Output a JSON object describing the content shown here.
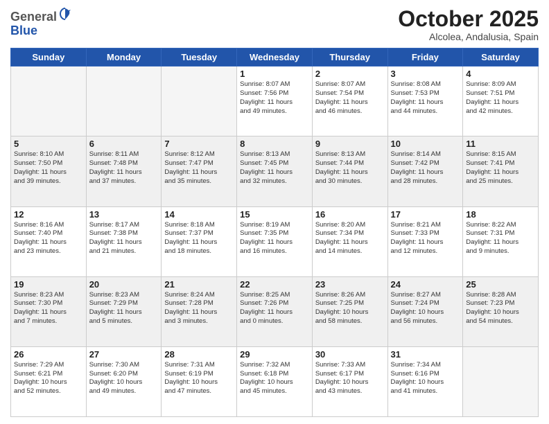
{
  "header": {
    "logo_general": "General",
    "logo_blue": "Blue",
    "month_title": "October 2025",
    "location": "Alcolea, Andalusia, Spain"
  },
  "days_of_week": [
    "Sunday",
    "Monday",
    "Tuesday",
    "Wednesday",
    "Thursday",
    "Friday",
    "Saturday"
  ],
  "weeks": [
    [
      {
        "day": "",
        "content": ""
      },
      {
        "day": "",
        "content": ""
      },
      {
        "day": "",
        "content": ""
      },
      {
        "day": "1",
        "content": "Sunrise: 8:07 AM\nSunset: 7:56 PM\nDaylight: 11 hours\nand 49 minutes."
      },
      {
        "day": "2",
        "content": "Sunrise: 8:07 AM\nSunset: 7:54 PM\nDaylight: 11 hours\nand 46 minutes."
      },
      {
        "day": "3",
        "content": "Sunrise: 8:08 AM\nSunset: 7:53 PM\nDaylight: 11 hours\nand 44 minutes."
      },
      {
        "day": "4",
        "content": "Sunrise: 8:09 AM\nSunset: 7:51 PM\nDaylight: 11 hours\nand 42 minutes."
      }
    ],
    [
      {
        "day": "5",
        "content": "Sunrise: 8:10 AM\nSunset: 7:50 PM\nDaylight: 11 hours\nand 39 minutes."
      },
      {
        "day": "6",
        "content": "Sunrise: 8:11 AM\nSunset: 7:48 PM\nDaylight: 11 hours\nand 37 minutes."
      },
      {
        "day": "7",
        "content": "Sunrise: 8:12 AM\nSunset: 7:47 PM\nDaylight: 11 hours\nand 35 minutes."
      },
      {
        "day": "8",
        "content": "Sunrise: 8:13 AM\nSunset: 7:45 PM\nDaylight: 11 hours\nand 32 minutes."
      },
      {
        "day": "9",
        "content": "Sunrise: 8:13 AM\nSunset: 7:44 PM\nDaylight: 11 hours\nand 30 minutes."
      },
      {
        "day": "10",
        "content": "Sunrise: 8:14 AM\nSunset: 7:42 PM\nDaylight: 11 hours\nand 28 minutes."
      },
      {
        "day": "11",
        "content": "Sunrise: 8:15 AM\nSunset: 7:41 PM\nDaylight: 11 hours\nand 25 minutes."
      }
    ],
    [
      {
        "day": "12",
        "content": "Sunrise: 8:16 AM\nSunset: 7:40 PM\nDaylight: 11 hours\nand 23 minutes."
      },
      {
        "day": "13",
        "content": "Sunrise: 8:17 AM\nSunset: 7:38 PM\nDaylight: 11 hours\nand 21 minutes."
      },
      {
        "day": "14",
        "content": "Sunrise: 8:18 AM\nSunset: 7:37 PM\nDaylight: 11 hours\nand 18 minutes."
      },
      {
        "day": "15",
        "content": "Sunrise: 8:19 AM\nSunset: 7:35 PM\nDaylight: 11 hours\nand 16 minutes."
      },
      {
        "day": "16",
        "content": "Sunrise: 8:20 AM\nSunset: 7:34 PM\nDaylight: 11 hours\nand 14 minutes."
      },
      {
        "day": "17",
        "content": "Sunrise: 8:21 AM\nSunset: 7:33 PM\nDaylight: 11 hours\nand 12 minutes."
      },
      {
        "day": "18",
        "content": "Sunrise: 8:22 AM\nSunset: 7:31 PM\nDaylight: 11 hours\nand 9 minutes."
      }
    ],
    [
      {
        "day": "19",
        "content": "Sunrise: 8:23 AM\nSunset: 7:30 PM\nDaylight: 11 hours\nand 7 minutes."
      },
      {
        "day": "20",
        "content": "Sunrise: 8:23 AM\nSunset: 7:29 PM\nDaylight: 11 hours\nand 5 minutes."
      },
      {
        "day": "21",
        "content": "Sunrise: 8:24 AM\nSunset: 7:28 PM\nDaylight: 11 hours\nand 3 minutes."
      },
      {
        "day": "22",
        "content": "Sunrise: 8:25 AM\nSunset: 7:26 PM\nDaylight: 11 hours\nand 0 minutes."
      },
      {
        "day": "23",
        "content": "Sunrise: 8:26 AM\nSunset: 7:25 PM\nDaylight: 10 hours\nand 58 minutes."
      },
      {
        "day": "24",
        "content": "Sunrise: 8:27 AM\nSunset: 7:24 PM\nDaylight: 10 hours\nand 56 minutes."
      },
      {
        "day": "25",
        "content": "Sunrise: 8:28 AM\nSunset: 7:23 PM\nDaylight: 10 hours\nand 54 minutes."
      }
    ],
    [
      {
        "day": "26",
        "content": "Sunrise: 7:29 AM\nSunset: 6:21 PM\nDaylight: 10 hours\nand 52 minutes."
      },
      {
        "day": "27",
        "content": "Sunrise: 7:30 AM\nSunset: 6:20 PM\nDaylight: 10 hours\nand 49 minutes."
      },
      {
        "day": "28",
        "content": "Sunrise: 7:31 AM\nSunset: 6:19 PM\nDaylight: 10 hours\nand 47 minutes."
      },
      {
        "day": "29",
        "content": "Sunrise: 7:32 AM\nSunset: 6:18 PM\nDaylight: 10 hours\nand 45 minutes."
      },
      {
        "day": "30",
        "content": "Sunrise: 7:33 AM\nSunset: 6:17 PM\nDaylight: 10 hours\nand 43 minutes."
      },
      {
        "day": "31",
        "content": "Sunrise: 7:34 AM\nSunset: 6:16 PM\nDaylight: 10 hours\nand 41 minutes."
      },
      {
        "day": "",
        "content": ""
      }
    ]
  ]
}
